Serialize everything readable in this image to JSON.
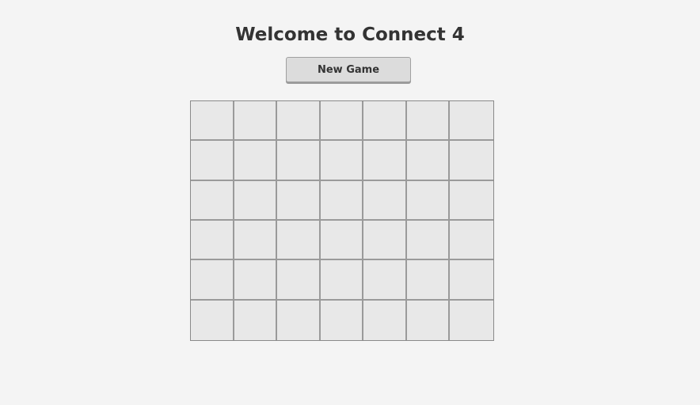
{
  "game": {
    "title": "Welcome to Connect 4",
    "new_game_label": "New Game",
    "board": {
      "columns": 7,
      "rows": 6,
      "cells": [
        [
          "",
          "",
          "",
          "",
          "",
          "",
          ""
        ],
        [
          "",
          "",
          "",
          "",
          "",
          "",
          ""
        ],
        [
          "",
          "",
          "",
          "",
          "",
          "",
          ""
        ],
        [
          "",
          "",
          "",
          "",
          "",
          "",
          ""
        ],
        [
          "",
          "",
          "",
          "",
          "",
          "",
          ""
        ],
        [
          "",
          "",
          "",
          "",
          "",
          "",
          ""
        ]
      ]
    }
  },
  "colors": {
    "background": "#f4f4f4",
    "cell_empty": "#e8e8e8",
    "grid_line": "#9a9a9a",
    "button_bg": "#dcdcdc",
    "text": "#333333"
  }
}
